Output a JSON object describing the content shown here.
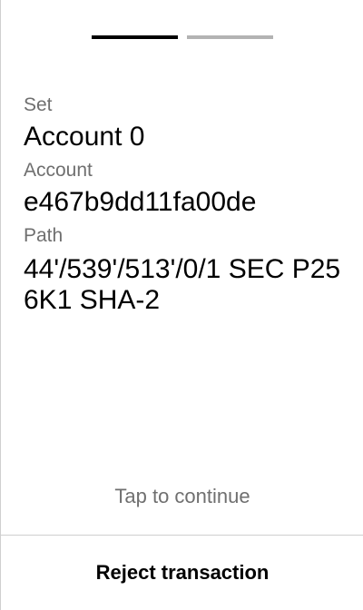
{
  "pager": {
    "total": 2,
    "current": 1
  },
  "fields": {
    "set": {
      "label": "Set",
      "value": "Account 0"
    },
    "account": {
      "label": "Account",
      "value": "e467b9dd11fa00de"
    },
    "path": {
      "label": "Path",
      "value": "44'/539'/513'/0/1 SEC P256K1 SHA-2"
    }
  },
  "footer": {
    "continue_text": "Tap to continue",
    "reject_label": "Reject transaction"
  },
  "colors": {
    "background": "#ffffff",
    "text": "#000000",
    "label_gray": "#6f6f6f",
    "pager_active": "#000000",
    "pager_inactive": "#b3b3b3",
    "divider": "#cfcfcf"
  }
}
